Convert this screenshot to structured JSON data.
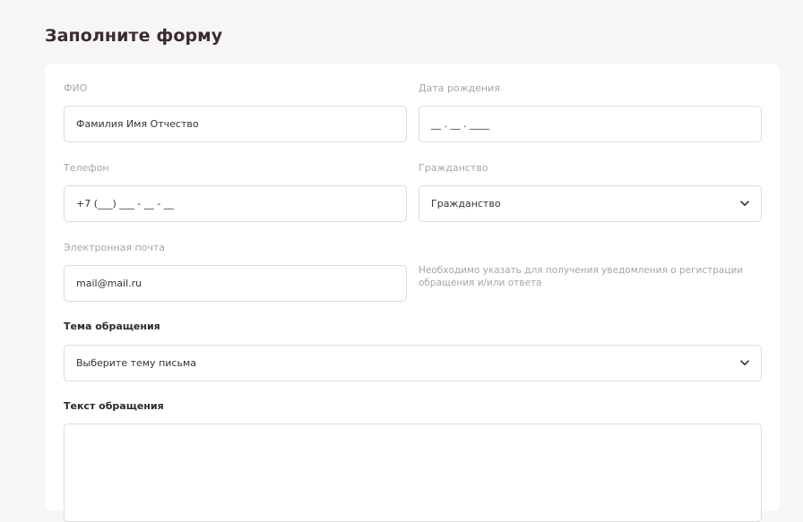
{
  "page_title": "Заполните форму",
  "form": {
    "fio": {
      "label": "ФИО",
      "placeholder": "Фамилия Имя Отчество"
    },
    "birthdate": {
      "label": "Дата рождения",
      "placeholder": "__ . __ . ____"
    },
    "phone": {
      "label": "Телефон",
      "placeholder": "+7 (___) ___ - __ - __"
    },
    "citizenship": {
      "label": "Гражданство",
      "value": "Гражданство"
    },
    "email": {
      "label": "Электронная почта",
      "placeholder": "mail@mail.ru",
      "hint": "Необходимо указать для получения уведомления о регистрации обращения и/или ответа"
    },
    "topic": {
      "label": "Тема обращения",
      "value": "Выберите тему письма"
    },
    "message": {
      "label": "Текст обращения"
    }
  },
  "icons": {
    "dropdown": "chevron-down-icon"
  }
}
